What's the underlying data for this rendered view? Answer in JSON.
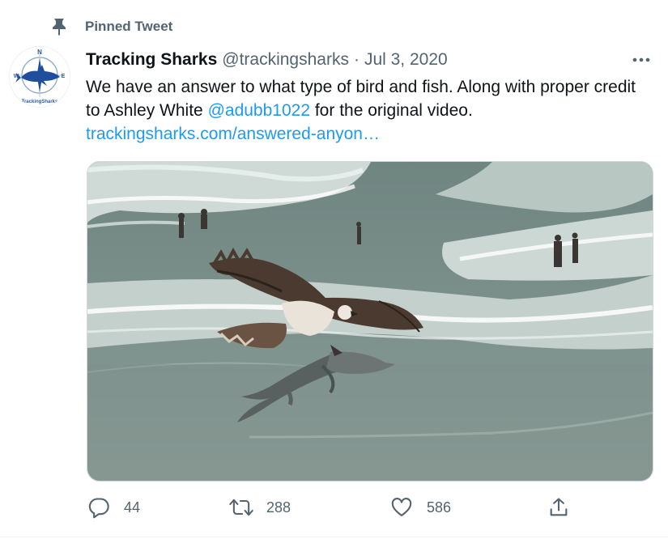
{
  "pinned": {
    "label": "Pinned Tweet",
    "icon": "pin-icon"
  },
  "avatar": {
    "icon": "compass-shark-logo",
    "logo_text": "TrackingSharks"
  },
  "author": {
    "name": "Tracking Sharks",
    "handle": "@trackingsharks",
    "separator": "·",
    "date": "Jul 3, 2020"
  },
  "tweet": {
    "text_part1": "We have an answer to what type of bird and fish. Along with proper credit to Ashley White ",
    "mention": "@adubb1022",
    "text_part2": " for the original video.",
    "link": "trackingsharks.com/answered-anyon…"
  },
  "media": {
    "description_icon": "osprey-carrying-shark-image"
  },
  "actions": {
    "reply": {
      "icon": "reply-icon",
      "count": "44"
    },
    "retweet": {
      "icon": "retweet-icon",
      "count": "288"
    },
    "like": {
      "icon": "heart-icon",
      "count": "586"
    },
    "share": {
      "icon": "share-icon"
    }
  },
  "colors": {
    "accent": "#1d9bf0",
    "secondary_text": "#536471",
    "primary_text": "#0f1419",
    "border": "#cfd9de"
  }
}
